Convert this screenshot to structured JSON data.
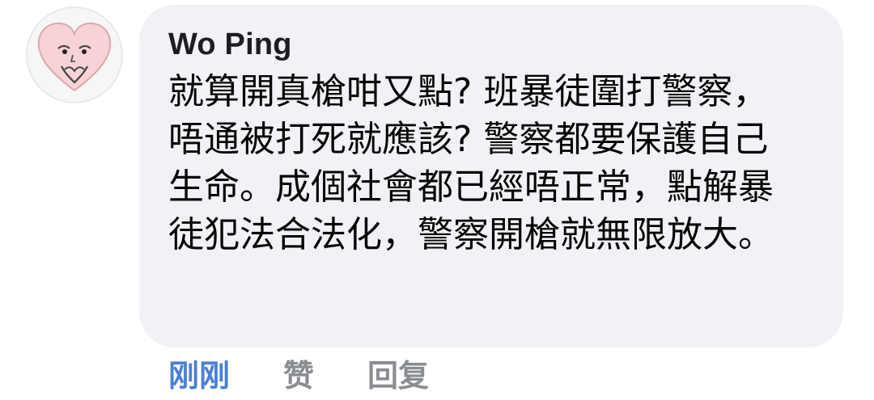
{
  "comment": {
    "author": "Wo Ping",
    "text": "就算開真槍咁又點? 班暴徒圍打警察，唔通被打死就應該? 警察都要保護自己生命。成個社會都已經唔正常，點解暴徒犯法合法化，警察開槍就無限放大。",
    "avatar_icon": "heart-face-avatar-icon"
  },
  "actions": {
    "time_label": "刚刚",
    "like_label": "赞",
    "reply_label": "回复"
  },
  "colors": {
    "bubble": "#f0f2f5",
    "time_link": "#4a7fd4",
    "action_gray": "#8a8d91",
    "avatar_heart": "#f7d3d6"
  }
}
